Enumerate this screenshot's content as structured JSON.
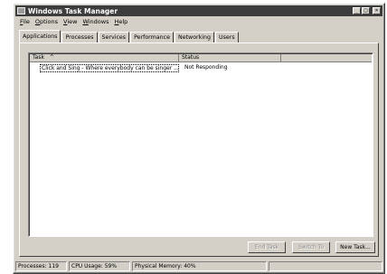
{
  "window": {
    "title": "Windows Task Manager",
    "controls": {
      "minimize": "_",
      "maximize": "□",
      "close": "×"
    }
  },
  "menu": [
    "File",
    "Options",
    "View",
    "Windows",
    "Help"
  ],
  "tabs": [
    "Applications",
    "Processes",
    "Services",
    "Performance",
    "Networking",
    "Users"
  ],
  "active_tab": "Applications",
  "list": {
    "columns": {
      "task": "Task",
      "status": "Status"
    },
    "sort_indicator": "^",
    "rows": [
      {
        "task": "Click and Sing - Where everybody can be singer ...",
        "status": "Not Responding"
      }
    ]
  },
  "buttons": {
    "end_task": "End Task",
    "switch_to": "Switch To",
    "new_task": "New Task..."
  },
  "status_bar": {
    "processes": "Processes: 119",
    "cpu": "CPU Usage: 59%",
    "memory": "Physical Memory: 40%"
  },
  "colors": {
    "window_face": "#d4d0c8",
    "titlebar": "#3c3c3c",
    "list_bg": "#ffffff"
  }
}
